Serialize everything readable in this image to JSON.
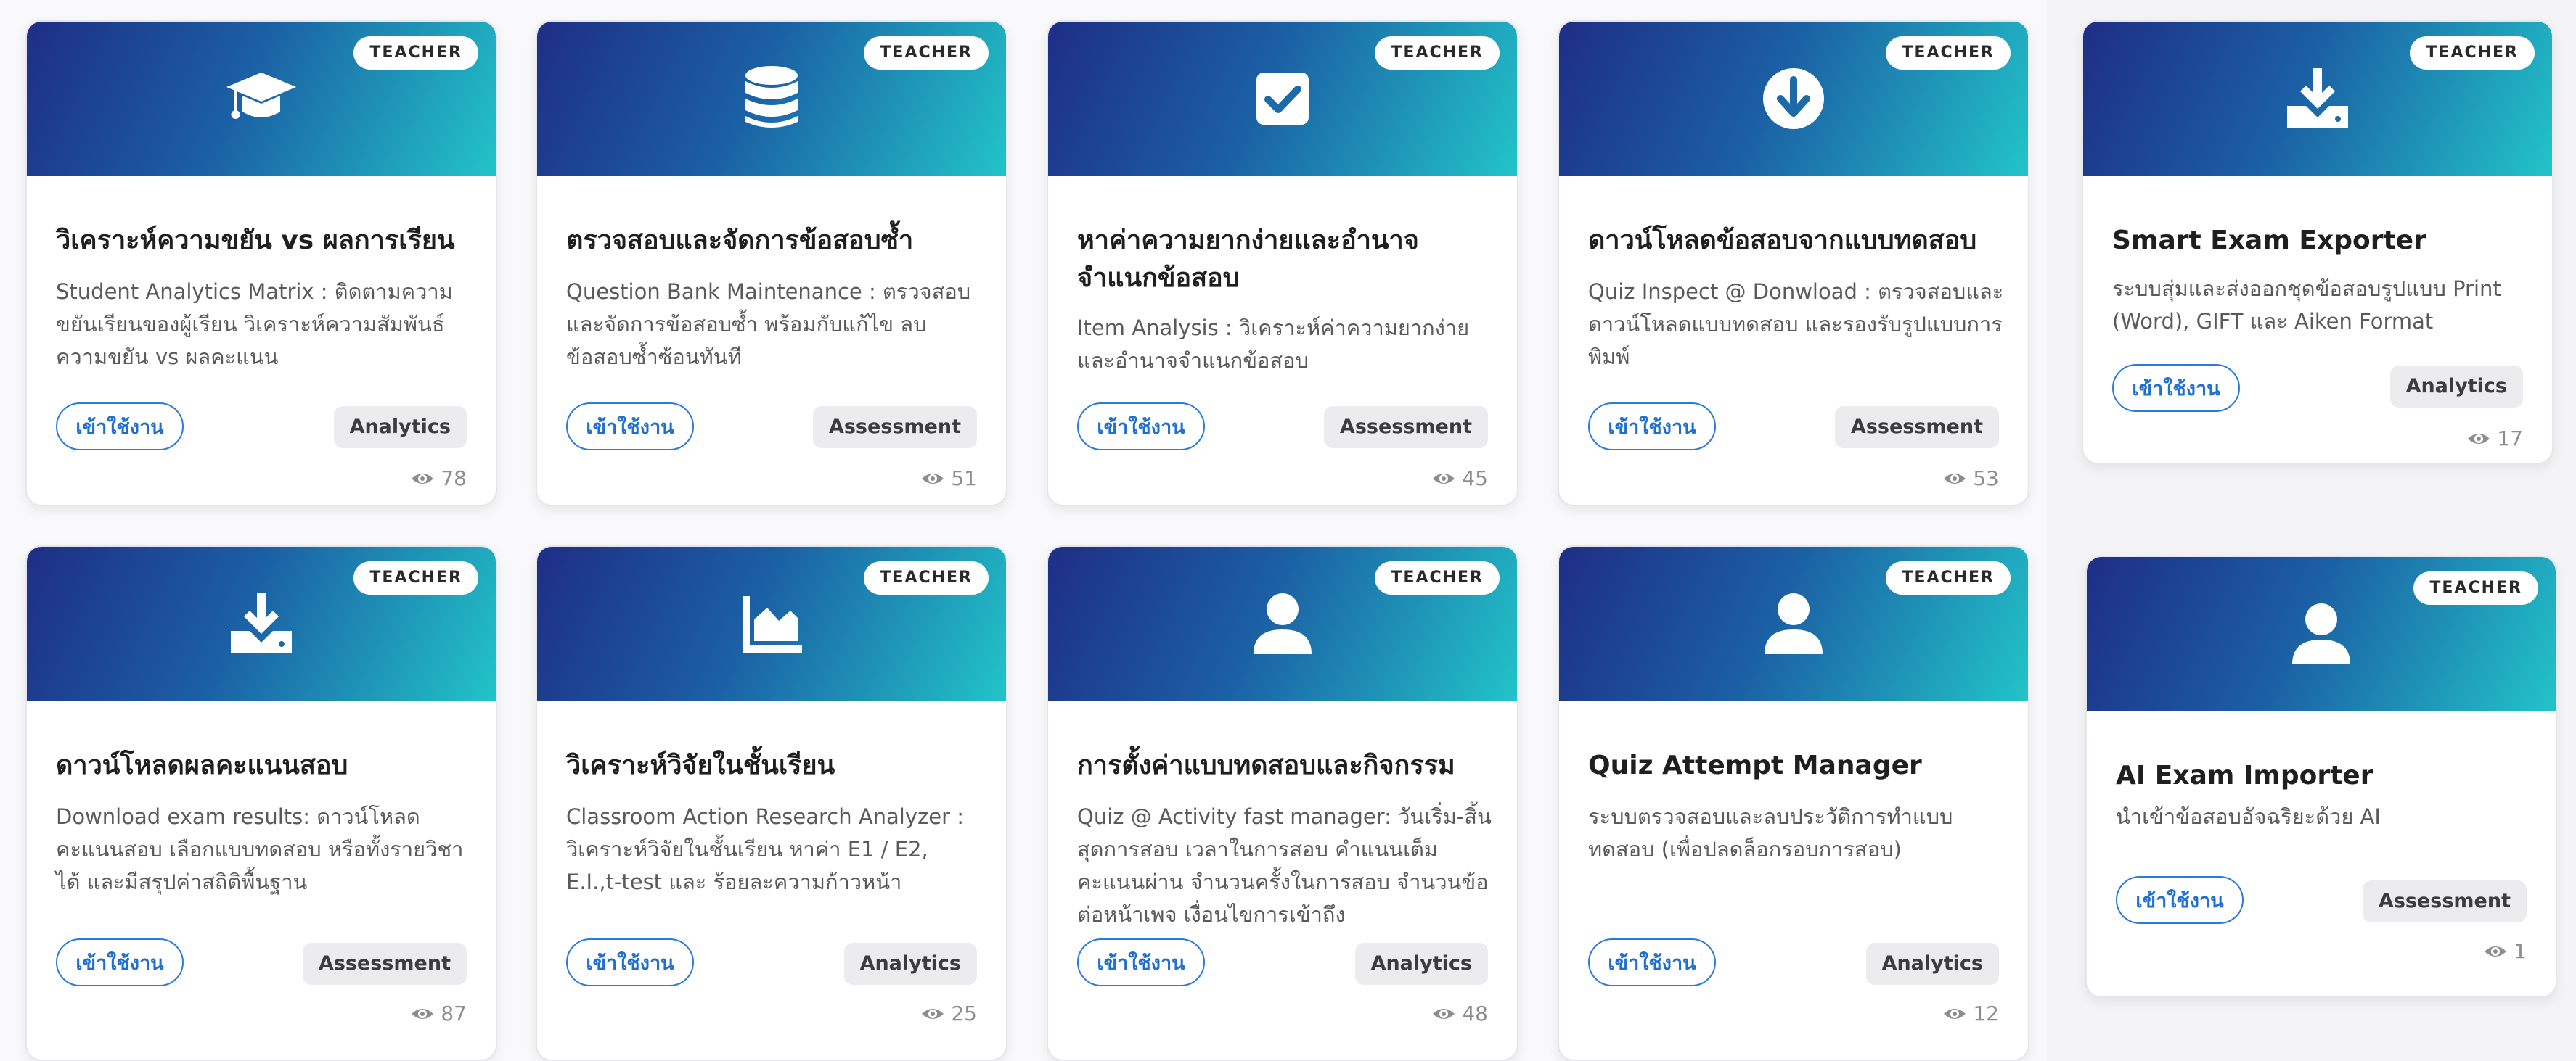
{
  "cards": [
    {
      "role": "TEACHER",
      "icon": "graduation-cap-icon",
      "title": "วิเคราะห์ความขยัน vs ผลการเรียน",
      "description": "Student Analytics Matrix : ติดตามความขยันเรียนของผู้เรียน วิเคราะห์ความสัมพันธ์ความขยัน vs ผลคะแนน",
      "button": "เข้าใช้งาน",
      "category": "Analytics",
      "views": "78"
    },
    {
      "role": "TEACHER",
      "icon": "database-icon",
      "title": "ตรวจสอบและจัดการข้อสอบซ้ำ",
      "description": "Question Bank Maintenance : ตรวจสอบและจัดการข้อสอบซ้ำ พร้อมกับแก้ไข ลบข้อสอบซ้ำซ้อนทันที",
      "button": "เข้าใช้งาน",
      "category": "Assessment",
      "views": "51"
    },
    {
      "role": "TEACHER",
      "icon": "check-square-icon",
      "title": "หาค่าความยากง่ายและอำนาจจำแนกข้อสอบ",
      "description": "Item Analysis : วิเคราะห์ค่าความยากง่ายและอำนาจจำแนกข้อสอบ",
      "button": "เข้าใช้งาน",
      "category": "Assessment",
      "views": "45"
    },
    {
      "role": "TEACHER",
      "icon": "download-circle-icon",
      "title": "ดาวน์โหลดข้อสอบจากแบบทดสอบ",
      "description": "Quiz Inspect @ Donwload : ตรวจสอบและดาวน์โหลดแบบทดสอบ และรองรับรูปแบบการพิมพ์",
      "button": "เข้าใช้งาน",
      "category": "Assessment",
      "views": "53"
    },
    {
      "role": "TEACHER",
      "icon": "download-tray-icon",
      "title": "Smart Exam Exporter",
      "description": "ระบบสุ่มและส่งออกชุดข้อสอบรูปแบบ Print (Word), GIFT และ Aiken Format",
      "button": "เข้าใช้งาน",
      "category": "Analytics",
      "views": "17"
    },
    {
      "role": "TEACHER",
      "icon": "download-tray-icon",
      "title": "ดาวน์โหลดผลคะแนนสอบ",
      "description": "Download exam results: ดาวน์โหลดคะแนนสอบ เลือกแบบทดสอบ หรือทั้งรายวิชาได้ และมีสรุปค่าสถิติพื้นฐาน",
      "button": "เข้าใช้งาน",
      "category": "Assessment",
      "views": "87"
    },
    {
      "role": "TEACHER",
      "icon": "area-chart-icon",
      "title": "วิเคราะห์วิจัยในชั้นเรียน",
      "description": "Classroom Action Research Analyzer : วิเคราะห์วิจัยในชั้นเรียน หาค่า E1 / E2, E.I.,t-test และ ร้อยละความก้าวหน้า",
      "button": "เข้าใช้งาน",
      "category": "Analytics",
      "views": "25"
    },
    {
      "role": "TEACHER",
      "icon": "user-icon",
      "title": "การตั้งค่าแบบทดสอบและกิจกรรม",
      "description": "Quiz @ Activity fast manager: วันเริ่ม-สิ้นสุดการสอบ เวลาในการสอบ คำแนนเต็ม คะแนนผ่าน จำนวนครั้งในการสอบ จำนวนข้อต่อหน้าเพจ เงื่อนไขการเข้าถึง",
      "button": "เข้าใช้งาน",
      "category": "Analytics",
      "views": "48"
    },
    {
      "role": "TEACHER",
      "icon": "user-icon",
      "title": "Quiz Attempt Manager",
      "description": "ระบบตรวจสอบและลบประวัติการทำแบบทดสอบ (เพื่อปลดล็อกรอบการสอบ)",
      "button": "เข้าใช้งาน",
      "category": "Analytics",
      "views": "12"
    },
    {
      "role": "TEACHER",
      "icon": "user-icon",
      "title": "AI Exam Importer",
      "description": "นำเข้าข้อสอบอัจฉริยะด้วย AI",
      "button": "เข้าใช้งาน",
      "category": "Assessment",
      "views": "1"
    }
  ]
}
